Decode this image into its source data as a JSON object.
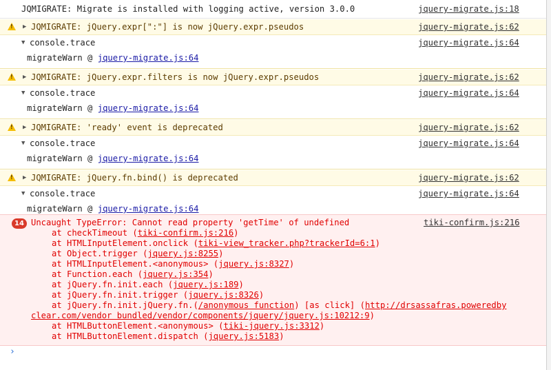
{
  "info": {
    "text": "JQMIGRATE: Migrate is installed with logging active, version 3.0.0",
    "source": "jquery-migrate.js:18"
  },
  "warnings": [
    {
      "message": "JQMIGRATE: jQuery.expr[\":\"] is now jQuery.expr.pseudos",
      "source": "jquery-migrate.js:62",
      "trace_label": "console.trace",
      "trace_source": "jquery-migrate.js:64",
      "frame_fn": "migrateWarn @ ",
      "frame_link": "jquery-migrate.js:64"
    },
    {
      "message": "JQMIGRATE: jQuery.expr.filters is now jQuery.expr.pseudos",
      "source": "jquery-migrate.js:62",
      "trace_label": "console.trace",
      "trace_source": "jquery-migrate.js:64",
      "frame_fn": "migrateWarn @ ",
      "frame_link": "jquery-migrate.js:64"
    },
    {
      "message": "JQMIGRATE: 'ready' event is deprecated",
      "source": "jquery-migrate.js:62",
      "trace_label": "console.trace",
      "trace_source": "jquery-migrate.js:64",
      "frame_fn": "migrateWarn @ ",
      "frame_link": "jquery-migrate.js:64"
    },
    {
      "message": "JQMIGRATE: jQuery.fn.bind() is deprecated",
      "source": "jquery-migrate.js:62",
      "trace_label": "console.trace",
      "trace_source": "jquery-migrate.js:64",
      "frame_fn": "migrateWarn @ ",
      "frame_link": "jquery-migrate.js:64"
    }
  ],
  "error": {
    "count": "14",
    "message": "Uncaught TypeError: Cannot read property 'getTime' of undefined",
    "source": "tiki-confirm.js:216",
    "stack": [
      {
        "pre": "at checkTimeout (",
        "link": "tiki-confirm.js:216",
        "post": ")"
      },
      {
        "pre": "at HTMLInputElement.onclick (",
        "link": "tiki-view_tracker.php?trackerId=6:1",
        "post": ")"
      },
      {
        "pre": "at Object.trigger (",
        "link": "jquery.js:8255",
        "post": ")"
      },
      {
        "pre": "at HTMLInputElement.<anonymous> (",
        "link": "jquery.js:8327",
        "post": ")"
      },
      {
        "pre": "at Function.each (",
        "link": "jquery.js:354",
        "post": ")"
      },
      {
        "pre": "at jQuery.fn.init.each (",
        "link": "jquery.js:189",
        "post": ")"
      },
      {
        "pre": "at jQuery.fn.init.trigger (",
        "link": "jquery.js:8326",
        "post": ")"
      },
      {
        "pre": "at jQuery.fn.init.jQuery.fn.(",
        "link": "/anonymous function",
        "post": ") [as click] (",
        "link2": "http://drsassafras.poweredby"
      },
      {
        "cont": true,
        "pre": "",
        "link": "clear.com/vendor bundled/vendor/components/jquery/jquery.js:10212:9",
        "post": ")"
      },
      {
        "pre": "at HTMLButtonElement.<anonymous> (",
        "link": "tiki-jquery.js:3312",
        "post": ")"
      },
      {
        "pre": "at HTMLButtonElement.dispatch (",
        "link": "jquery.js:5183",
        "post": ")"
      }
    ]
  },
  "prompt_symbol": "›",
  "colors": {
    "warning_bg": "#fffbe6",
    "warning_text": "#5c3c00",
    "error_bg": "#fff0f0",
    "error_text": "#e00000",
    "link": "#1a1aa6"
  }
}
